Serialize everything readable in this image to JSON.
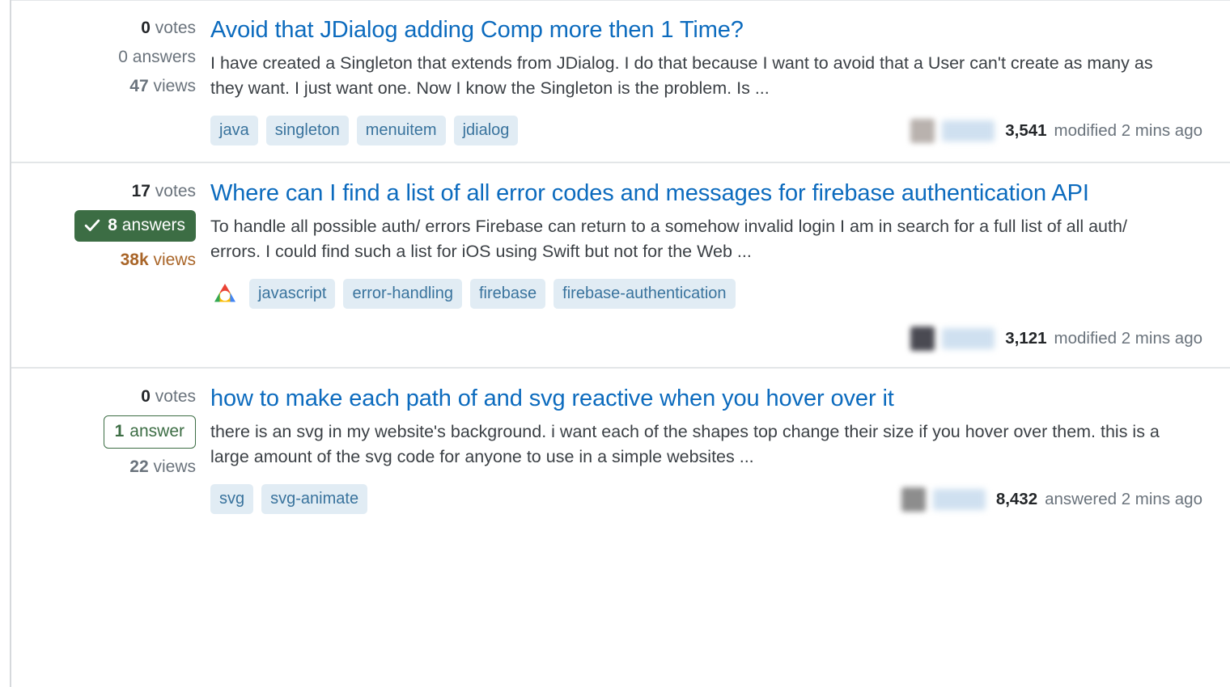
{
  "colors": {
    "link": "#0c6bbe",
    "tag_bg": "#e1ecf4",
    "tag_fg": "#39739d",
    "accepted_green": "#3c6d44",
    "hot_views": "#a96528",
    "border": "#e3e6e8"
  },
  "questions": [
    {
      "votes": {
        "count": "0",
        "label": "votes"
      },
      "answers": {
        "count": "0",
        "label": "answers",
        "state": "none"
      },
      "views": {
        "count": "47",
        "label": "views",
        "hot": false
      },
      "title": "Avoid that JDialog adding Comp more then 1 Time?",
      "excerpt": "I have created a Singleton that extends from JDialog. I do that because I want to avoid that a User can't create as many as they want. I just want one. Now I know the Singleton is the problem. Is ...",
      "brand_icon": null,
      "tags": [
        "java",
        "singleton",
        "menuitem",
        "jdialog"
      ],
      "user": {
        "name": "",
        "reputation": "3,541",
        "action": "modified",
        "time": "2 mins ago",
        "avatar_tone": "brown"
      },
      "meta_layout": "inline"
    },
    {
      "votes": {
        "count": "17",
        "label": "votes"
      },
      "answers": {
        "count": "8",
        "label": "answers",
        "state": "accepted"
      },
      "views": {
        "count": "38k",
        "label": "views",
        "hot": true
      },
      "title": "Where can I find a list of all error codes and messages for firebase authen­tication API",
      "excerpt": "To handle all possible auth/ errors Firebase can return to a somehow invalid login I am in search for a full list of all auth/ errors. I could find such a list for iOS using Swift but not for the Web ...",
      "brand_icon": "google-cloud-icon",
      "tags": [
        "javascript",
        "error-handling",
        "firebase",
        "firebase-authentication"
      ],
      "user": {
        "name": "",
        "reputation": "3,121",
        "action": "modified",
        "time": "2 mins ago",
        "avatar_tone": "dark"
      },
      "meta_layout": "stacked"
    },
    {
      "votes": {
        "count": "0",
        "label": "votes"
      },
      "answers": {
        "count": "1",
        "label": "answer",
        "state": "answered"
      },
      "views": {
        "count": "22",
        "label": "views",
        "hot": false
      },
      "title": "how to make each path of and svg reactive when you hover over it",
      "excerpt": "there is an svg in my website's background. i want each of the shapes top change their size if you hover over them. this is a large amount of the svg code for anyone to use in a simple websites ...",
      "brand_icon": null,
      "tags": [
        "svg",
        "svg-animate"
      ],
      "user": {
        "name": "",
        "reputation": "8,432",
        "action": "answered",
        "time": "2 mins ago",
        "avatar_tone": "gray"
      },
      "meta_layout": "inline"
    }
  ]
}
